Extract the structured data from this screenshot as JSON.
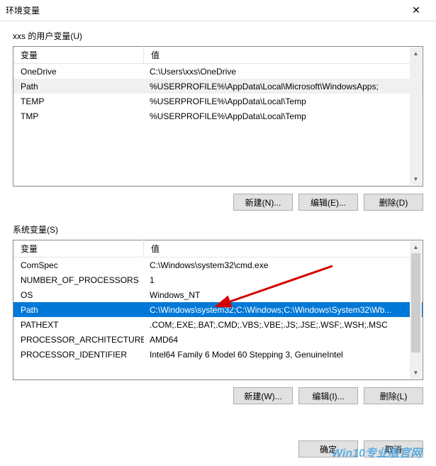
{
  "window": {
    "title": "环境变量"
  },
  "user_vars": {
    "group_label": "xxs 的用户变量(U)",
    "headers": {
      "name": "变量",
      "value": "值"
    },
    "rows": [
      {
        "name": "OneDrive",
        "value": "C:\\Users\\xxs\\OneDrive"
      },
      {
        "name": "Path",
        "value": "%USERPROFILE%\\AppData\\Local\\Microsoft\\WindowsApps;"
      },
      {
        "name": "TEMP",
        "value": "%USERPROFILE%\\AppData\\Local\\Temp"
      },
      {
        "name": "TMP",
        "value": "%USERPROFILE%\\AppData\\Local\\Temp"
      }
    ],
    "buttons": {
      "new": "新建(N)...",
      "edit": "编辑(E)...",
      "delete": "删除(D)"
    }
  },
  "system_vars": {
    "group_label": "系统变量(S)",
    "headers": {
      "name": "变量",
      "value": "值"
    },
    "rows": [
      {
        "name": "ComSpec",
        "value": "C:\\Windows\\system32\\cmd.exe"
      },
      {
        "name": "NUMBER_OF_PROCESSORS",
        "value": "1"
      },
      {
        "name": "OS",
        "value": "Windows_NT"
      },
      {
        "name": "Path",
        "value": "C:\\Windows\\system32;C:\\Windows;C:\\Windows\\System32\\Wb..."
      },
      {
        "name": "PATHEXT",
        "value": ".COM;.EXE;.BAT;.CMD;.VBS;.VBE;.JS;.JSE;.WSF;.WSH;.MSC"
      },
      {
        "name": "PROCESSOR_ARCHITECTURE",
        "value": "AMD64"
      },
      {
        "name": "PROCESSOR_IDENTIFIER",
        "value": "Intel64 Family 6 Model 60 Stepping 3, GenuineIntel"
      }
    ],
    "buttons": {
      "new": "新建(W)...",
      "edit": "编辑(I)...",
      "delete": "删除(L)"
    }
  },
  "dialog_buttons": {
    "ok": "确定",
    "cancel": "取消"
  },
  "watermark": "Win10专业版官网"
}
